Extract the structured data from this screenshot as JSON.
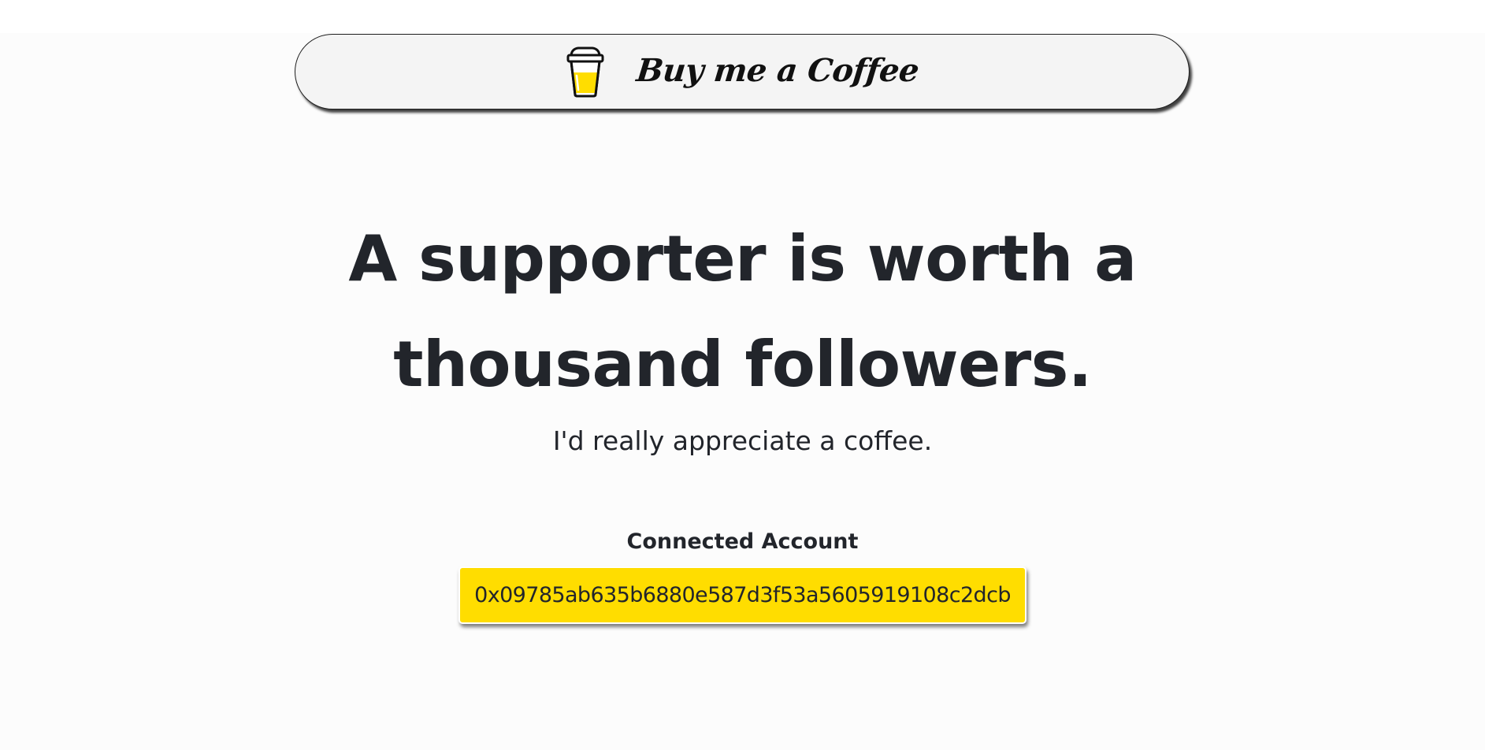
{
  "header": {
    "logo_icon": "coffee-cup-icon",
    "brand_name": "Buy me a Coffee"
  },
  "hero": {
    "headline_line1": "A supporter is worth a",
    "headline_line2": "thousand followers.",
    "subtitle": "I'd really appreciate a coffee."
  },
  "account": {
    "label": "Connected Account",
    "address": "0x09785ab635b6880e587d3f53a5605919108c2dcb"
  },
  "colors": {
    "accent": "#ffdd00",
    "text": "#22252b",
    "background": "#fcfcfc"
  }
}
